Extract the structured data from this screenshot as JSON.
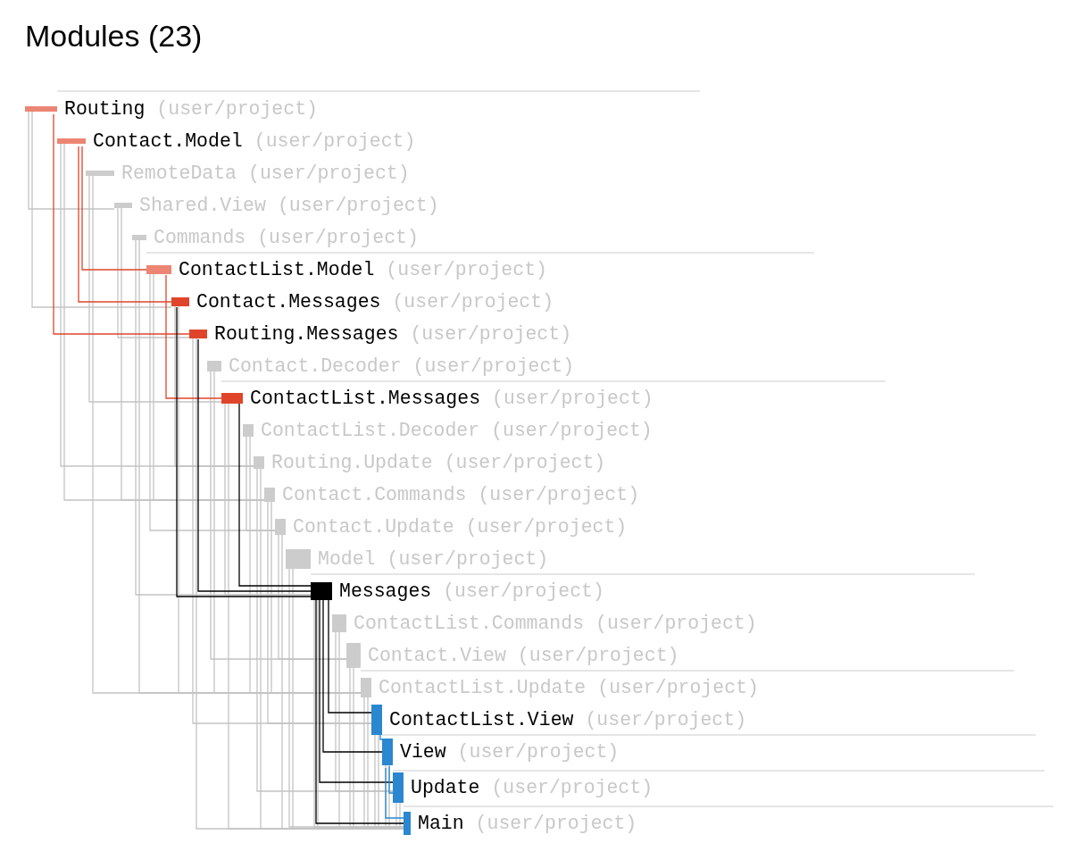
{
  "title": "Modules (23)",
  "modules": [
    {
      "name": "Routing",
      "path": "(user/project)",
      "color": "#ec8574",
      "dimmed": false
    },
    {
      "name": "Contact.Model",
      "path": "(user/project)",
      "color": "#ec8574",
      "dimmed": false
    },
    {
      "name": "RemoteData",
      "path": "(user/project)",
      "color": "#cccccc",
      "dimmed": true
    },
    {
      "name": "Shared.View",
      "path": "(user/project)",
      "color": "#cccccc",
      "dimmed": true
    },
    {
      "name": "Commands",
      "path": "(user/project)",
      "color": "#cccccc",
      "dimmed": true
    },
    {
      "name": "ContactList.Model",
      "path": "(user/project)",
      "color": "#ec8574",
      "dimmed": false
    },
    {
      "name": "Contact.Messages",
      "path": "(user/project)",
      "color": "#e0452b",
      "dimmed": false
    },
    {
      "name": "Routing.Messages",
      "path": "(user/project)",
      "color": "#e0452b",
      "dimmed": false
    },
    {
      "name": "Contact.Decoder",
      "path": "(user/project)",
      "color": "#cccccc",
      "dimmed": true
    },
    {
      "name": "ContactList.Messages",
      "path": "(user/project)",
      "color": "#e0452b",
      "dimmed": false
    },
    {
      "name": "ContactList.Decoder",
      "path": "(user/project)",
      "color": "#cccccc",
      "dimmed": true
    },
    {
      "name": "Routing.Update",
      "path": "(user/project)",
      "color": "#cccccc",
      "dimmed": true
    },
    {
      "name": "Contact.Commands",
      "path": "(user/project)",
      "color": "#cccccc",
      "dimmed": true
    },
    {
      "name": "Contact.Update",
      "path": "(user/project)",
      "color": "#cccccc",
      "dimmed": true
    },
    {
      "name": "Model",
      "path": "(user/project)",
      "color": "#cccccc",
      "dimmed": true
    },
    {
      "name": "Messages",
      "path": "(user/project)",
      "color": "#000000",
      "dimmed": false
    },
    {
      "name": "ContactList.Commands",
      "path": "(user/project)",
      "color": "#cccccc",
      "dimmed": true
    },
    {
      "name": "Contact.View",
      "path": "(user/project)",
      "color": "#cccccc",
      "dimmed": true
    },
    {
      "name": "ContactList.Update",
      "path": "(user/project)",
      "color": "#cccccc",
      "dimmed": true
    },
    {
      "name": "ContactList.View",
      "path": "(user/project)",
      "color": "#2a87d0",
      "dimmed": false
    },
    {
      "name": "View",
      "path": "(user/project)",
      "color": "#2a87d0",
      "dimmed": false
    },
    {
      "name": "Update",
      "path": "(user/project)",
      "color": "#2a87d0",
      "dimmed": false
    },
    {
      "name": "Main",
      "path": "(user/project)",
      "color": "#2a87d0",
      "dimmed": false
    }
  ]
}
